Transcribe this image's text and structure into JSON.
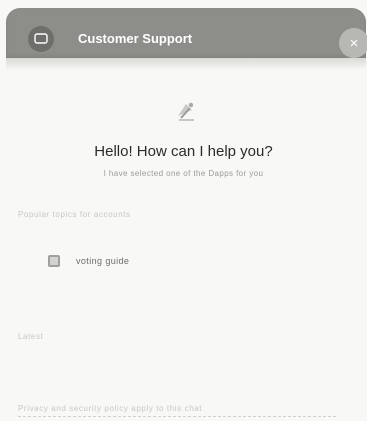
{
  "header": {
    "title": "Customer Support",
    "close_glyph": "×",
    "chat_icon": "chat-bubble-icon",
    "color": "#8d8d89"
  },
  "bot": {
    "avatar_icon": "bot-avatar-icon"
  },
  "greeting": {
    "title": "Hello! How can I help you?",
    "subtitle": "I have selected one of the Dapps for you"
  },
  "sections": {
    "popular_label": "Popular topics for accounts",
    "recent_label": "Latest",
    "footer_label": "Privacy and security policy apply to this chat"
  },
  "options": [
    {
      "icon": "image-icon",
      "label": "voting guide"
    }
  ]
}
